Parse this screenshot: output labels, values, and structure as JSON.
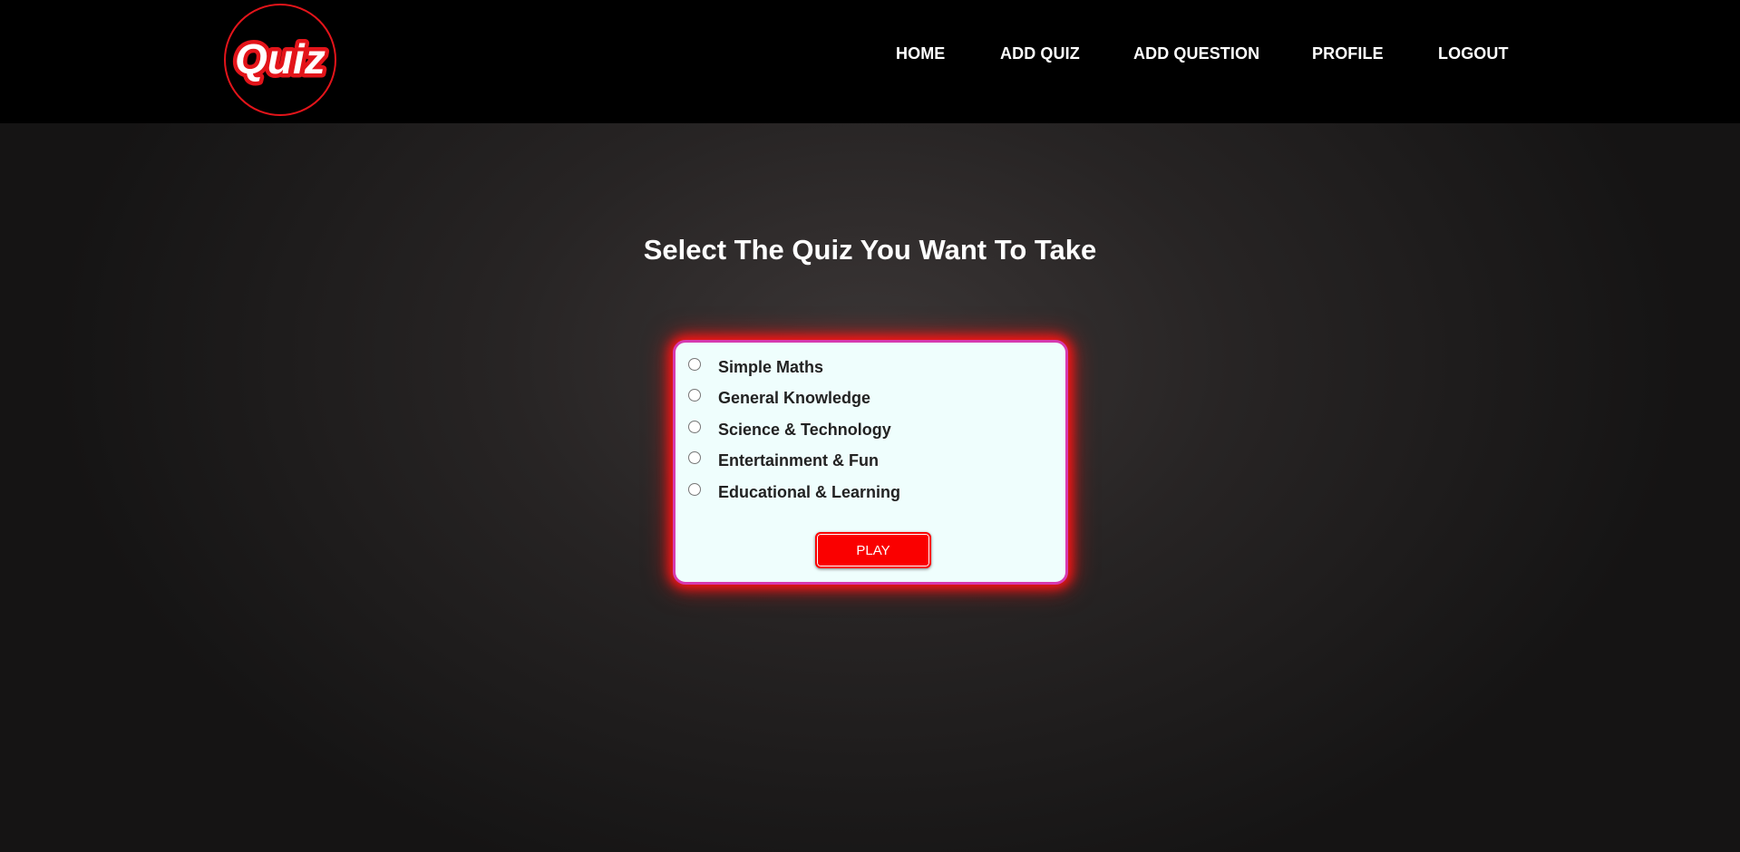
{
  "logo": {
    "text": "Quiz",
    "icon": "quiz-logo",
    "color": "#e3141a"
  },
  "nav": {
    "items": [
      {
        "label": "HOME"
      },
      {
        "label": "ADD QUIZ"
      },
      {
        "label": "ADD QUESTION"
      },
      {
        "label": "PROFILE"
      },
      {
        "label": "LOGOUT"
      }
    ]
  },
  "main": {
    "title": "Select The Quiz You Want To Take",
    "options": [
      {
        "label": "Simple Maths",
        "checked": false
      },
      {
        "label": "General Knowledge",
        "checked": false
      },
      {
        "label": "Science & Technology",
        "checked": false
      },
      {
        "label": "Entertainment & Fun",
        "checked": false
      },
      {
        "label": "Educational & Learning",
        "checked": false
      }
    ],
    "play_label": "PLAY"
  },
  "colors": {
    "accent": "#fa0000",
    "card_background": "#effefd",
    "card_border": "#d63ab0",
    "navbar": "#000000"
  }
}
